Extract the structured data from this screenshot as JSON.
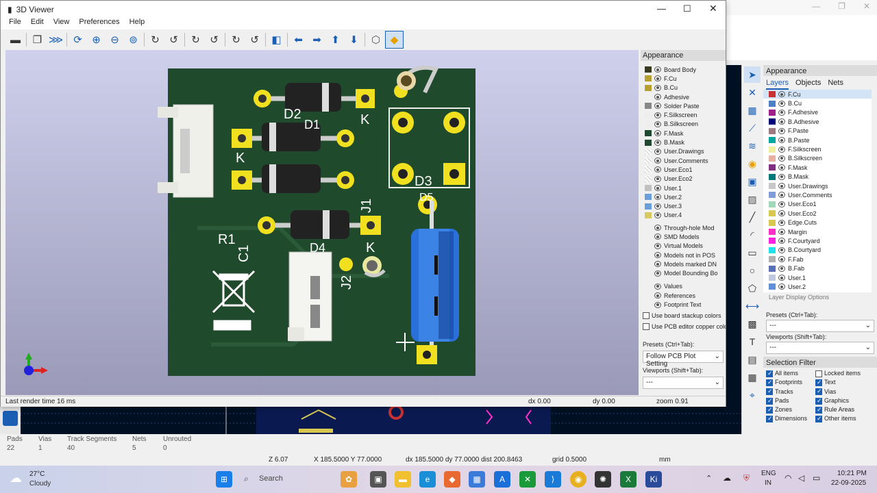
{
  "viewer": {
    "title": "3D Viewer",
    "menu": [
      "File",
      "Edit",
      "View",
      "Preferences",
      "Help"
    ],
    "status": {
      "render": "Last render time 16 ms",
      "dx": "dx 0.00",
      "dy": "dy 0.00",
      "zoom": "zoom 0.91"
    },
    "appearance_title": "Appearance",
    "layers": [
      {
        "name": "Board Body",
        "color": "#3a3a20"
      },
      {
        "name": "F.Cu",
        "color": "#b8a030"
      },
      {
        "name": "B.Cu",
        "color": "#b8a030"
      },
      {
        "name": "Adhesive",
        "color": ""
      },
      {
        "name": "Solder Paste",
        "color": "#888888"
      },
      {
        "name": "F.Silkscreen",
        "color": "#eeeeee"
      },
      {
        "name": "B.Silkscreen",
        "color": "#eeeeee"
      },
      {
        "name": "F.Mask",
        "color": "#204a30"
      },
      {
        "name": "B.Mask",
        "color": "#204a30"
      },
      {
        "name": "User.Drawings",
        "color": "checker"
      },
      {
        "name": "User.Comments",
        "color": "checker"
      },
      {
        "name": "User.Eco1",
        "color": "checker"
      },
      {
        "name": "User.Eco2",
        "color": "checker"
      },
      {
        "name": "User.1",
        "color": "#c0c0c0"
      },
      {
        "name": "User.2",
        "color": "#6a9fdc"
      },
      {
        "name": "User.3",
        "color": "#6a9fdc"
      },
      {
        "name": "User.4",
        "color": "#d8c860"
      }
    ],
    "models": [
      "Through-hole Mod",
      "SMD Models",
      "Virtual Models",
      "Models not in POS",
      "Models marked DN",
      "Model Bounding Bo"
    ],
    "text_items": [
      "Values",
      "References",
      "Footprint Text"
    ],
    "options": [
      "Use board stackup colors",
      "Use PCB editor copper colo"
    ],
    "presets_label": "Presets (Ctrl+Tab):",
    "presets_value": "Follow PCB Plot Setting",
    "viewports_label": "Viewports (Shift+Tab):",
    "viewports_value": "---",
    "silk": {
      "d2": "D2",
      "d1": "D1",
      "k1": "K",
      "k2": "K",
      "k3": "K",
      "d3": "D3",
      "d5": "D5",
      "j1": "J1",
      "r1": "R1",
      "c1": "C1",
      "d4": "D4",
      "j2": "J2"
    }
  },
  "editor": {
    "appearance_title": "Appearance",
    "tabs": [
      "Layers",
      "Objects",
      "Nets"
    ],
    "layers": [
      {
        "name": "F.Cu",
        "color": "#c83232"
      },
      {
        "name": "B.Cu",
        "color": "#4d7fc4"
      },
      {
        "name": "F.Adhesive",
        "color": "#a0208a"
      },
      {
        "name": "B.Adhesive",
        "color": "#00007a"
      },
      {
        "name": "F.Paste",
        "color": "#a07880"
      },
      {
        "name": "B.Paste",
        "color": "#00a8a0"
      },
      {
        "name": "F.Silkscreen",
        "color": "#f0f0a0"
      },
      {
        "name": "B.Silkscreen",
        "color": "#e8b0a0"
      },
      {
        "name": "F.Mask",
        "color": "#803080"
      },
      {
        "name": "B.Mask",
        "color": "#007878"
      },
      {
        "name": "User.Drawings",
        "color": "#c8c8c8"
      },
      {
        "name": "User.Comments",
        "color": "#7f9cd8"
      },
      {
        "name": "User.Eco1",
        "color": "#a0d8b8"
      },
      {
        "name": "User.Eco2",
        "color": "#d8c850"
      },
      {
        "name": "Edge.Cuts",
        "color": "#d8c850"
      },
      {
        "name": "Margin",
        "color": "#ff30c8"
      },
      {
        "name": "F.Courtyard",
        "color": "#ff20e0"
      },
      {
        "name": "B.Courtyard",
        "color": "#20e0e8"
      },
      {
        "name": "F.Fab",
        "color": "#b0b0b0"
      },
      {
        "name": "B.Fab",
        "color": "#5870b8"
      },
      {
        "name": "User.1",
        "color": "#c0c8e0"
      },
      {
        "name": "User.2",
        "color": "#6090d8"
      }
    ],
    "layer_display_options": "Layer Display Options",
    "presets_label": "Presets (Ctrl+Tab):",
    "presets_value": "---",
    "viewports_label": "Viewports (Shift+Tab):",
    "viewports_value": "---",
    "selection_filter_title": "Selection Filter",
    "filters_left": [
      {
        "label": "All items",
        "checked": true
      },
      {
        "label": "Footprints",
        "checked": true
      },
      {
        "label": "Tracks",
        "checked": true
      },
      {
        "label": "Pads",
        "checked": true
      },
      {
        "label": "Zones",
        "checked": true
      },
      {
        "label": "Dimensions",
        "checked": true
      }
    ],
    "filters_right": [
      {
        "label": "Locked items",
        "checked": false
      },
      {
        "label": "Text",
        "checked": true
      },
      {
        "label": "Vias",
        "checked": true
      },
      {
        "label": "Graphics",
        "checked": true
      },
      {
        "label": "Rule Areas",
        "checked": true
      },
      {
        "label": "Other items",
        "checked": true
      }
    ],
    "stats": {
      "headers": [
        "Pads",
        "Vias",
        "Track Segments",
        "Nets",
        "Unrouted"
      ],
      "values": [
        "22",
        "1",
        "40",
        "5",
        "0"
      ]
    },
    "coords": {
      "z": "Z 6.07",
      "xy": "X 185.5000  Y 77.0000",
      "dxdy": "dx 185.5000  dy 77.0000  dist 200.8463",
      "grid": "grid 0.5000",
      "unit": "mm"
    }
  },
  "taskbar": {
    "weather_temp": "27°C",
    "weather_desc": "Cloudy",
    "search": "Search",
    "lang1": "ENG",
    "lang2": "IN",
    "time": "10:21 PM",
    "date": "22-09-2025"
  }
}
